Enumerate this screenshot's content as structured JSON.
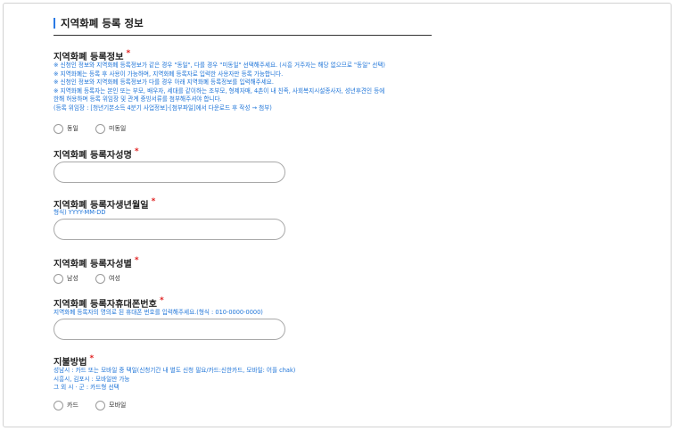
{
  "section": {
    "title": "지역화폐 등록 정보"
  },
  "registration_info": {
    "label": "지역화폐 등록정보",
    "required_mark": "*",
    "notes": [
      "※ 신청인 정보와 지역화폐 등록정보가 같은 경우 \"동일\", 다를 경우 \"미동일\" 선택해주세요. (시흥 거주자는 해당 없으므로 \"동일\" 선택)",
      "※ 지역화폐는 등록 후 사용이 가능하며, 지역화폐 등록자로 입력한 사용자만 등록 가능합니다.",
      "※ 신청인 정보와 지역화폐 등록정보가 다를 경우 아래 지역화폐 등록정보를 입력해주세요.",
      "※ 지역화폐 등록자는 본인 또는 부모, 배우자, 세대를 같이하는 조부모, 형제자매, 4촌이 내 친족, 사회복지시설종사자, 성년후견인 등에",
      "한해 허용하며 등록 위임장 및 관계 증빙서류를 첨부해주셔야 합니다.",
      "(등록 위임장 : [청년기본소득 4분기 사업정보]-[첨부파일]에서 다운로드 후 작성 → 첨부)"
    ],
    "options": [
      "동일",
      "미동일"
    ]
  },
  "registrant_name": {
    "label": "지역화폐 등록자성명",
    "required_mark": "*",
    "value": ""
  },
  "registrant_birth": {
    "label": "지역화폐 등록자생년월일",
    "required_mark": "*",
    "hint": "형식) YYYY-MM-DD",
    "value": ""
  },
  "registrant_gender": {
    "label": "지역화폐 등록자성별",
    "required_mark": "*",
    "options": [
      "남성",
      "여성"
    ]
  },
  "registrant_phone": {
    "label": "지역화폐 등록자휴대폰번호",
    "required_mark": "*",
    "hint": "지역화폐 등록자의 명의로 된 휴대폰 번호를 입력해주세요.(형식 : 010-0000-0000)",
    "value": ""
  },
  "payment": {
    "label": "지불방법",
    "required_mark": "*",
    "notes": [
      "성남시 : 카드 또는 모바일 중 택일(신청기간 내 별도 신청 필요/카드:신한카드, 모바일: 어플 chak)",
      "시흥시, 김포시 : 모바일만 가능",
      "그 외 시 · 군 : 카드형 선택"
    ],
    "options": [
      "카드",
      "모바일"
    ]
  },
  "colors": {
    "accent": "#1e74d8",
    "required": "#e02020",
    "border": "#a9a9a9"
  }
}
